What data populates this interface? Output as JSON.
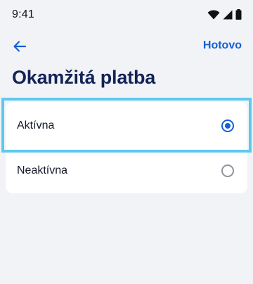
{
  "status_bar": {
    "time": "9:41"
  },
  "header": {
    "done_label": "Hotovo"
  },
  "page": {
    "title": "Okamžitá platba"
  },
  "options": [
    {
      "label": "Aktívna",
      "selected": true
    },
    {
      "label": "Neaktívna",
      "selected": false
    }
  ],
  "icons": {
    "back": "arrow-left-icon",
    "wifi": "wifi-icon",
    "signal": "signal-icon",
    "battery": "battery-icon"
  },
  "colors": {
    "accent": "#1460d4",
    "title": "#122356",
    "background": "#f2f3f7",
    "highlight": "#5fc8ee"
  }
}
